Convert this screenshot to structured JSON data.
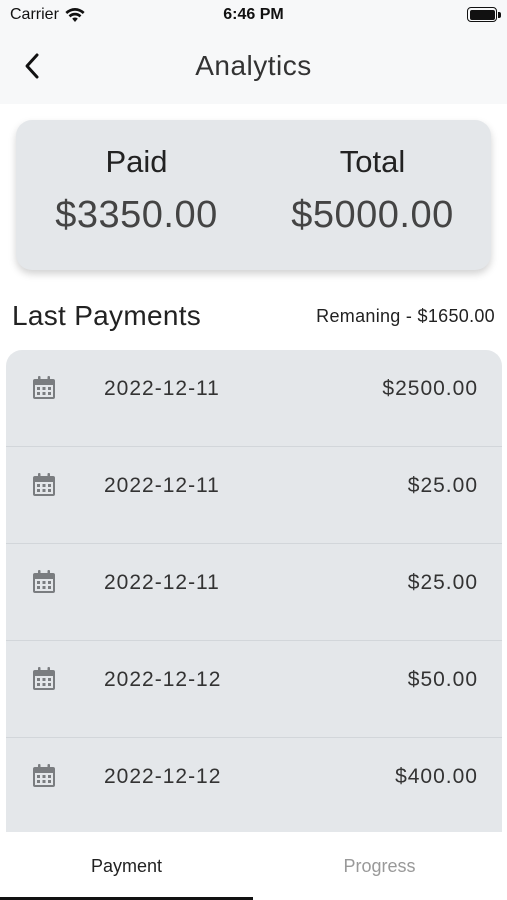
{
  "status_bar": {
    "carrier": "Carrier",
    "time": "6:46 PM"
  },
  "nav": {
    "title": "Analytics"
  },
  "summary": {
    "paid_label": "Paid",
    "paid_value": "$3350.00",
    "total_label": "Total",
    "total_value": "$5000.00"
  },
  "payments": {
    "section_title": "Last Payments",
    "remaining": "Remaning - $1650.00",
    "items": [
      {
        "date": "2022-12-11",
        "amount": "$2500.00"
      },
      {
        "date": "2022-12-11",
        "amount": "$25.00"
      },
      {
        "date": "2022-12-11",
        "amount": "$25.00"
      },
      {
        "date": "2022-12-12",
        "amount": "$50.00"
      },
      {
        "date": "2022-12-12",
        "amount": "$400.00"
      }
    ]
  },
  "tabs": [
    {
      "label": "Payment",
      "active": true
    },
    {
      "label": "Progress",
      "active": false
    }
  ],
  "colors": {
    "card_bg": "#e4e7ea",
    "active_tab": "#111111",
    "inactive_tab": "#999999"
  },
  "icons": {
    "back": "chevron-left-icon",
    "wifi": "wifi-icon",
    "battery": "battery-icon",
    "calendar": "calendar-icon"
  }
}
